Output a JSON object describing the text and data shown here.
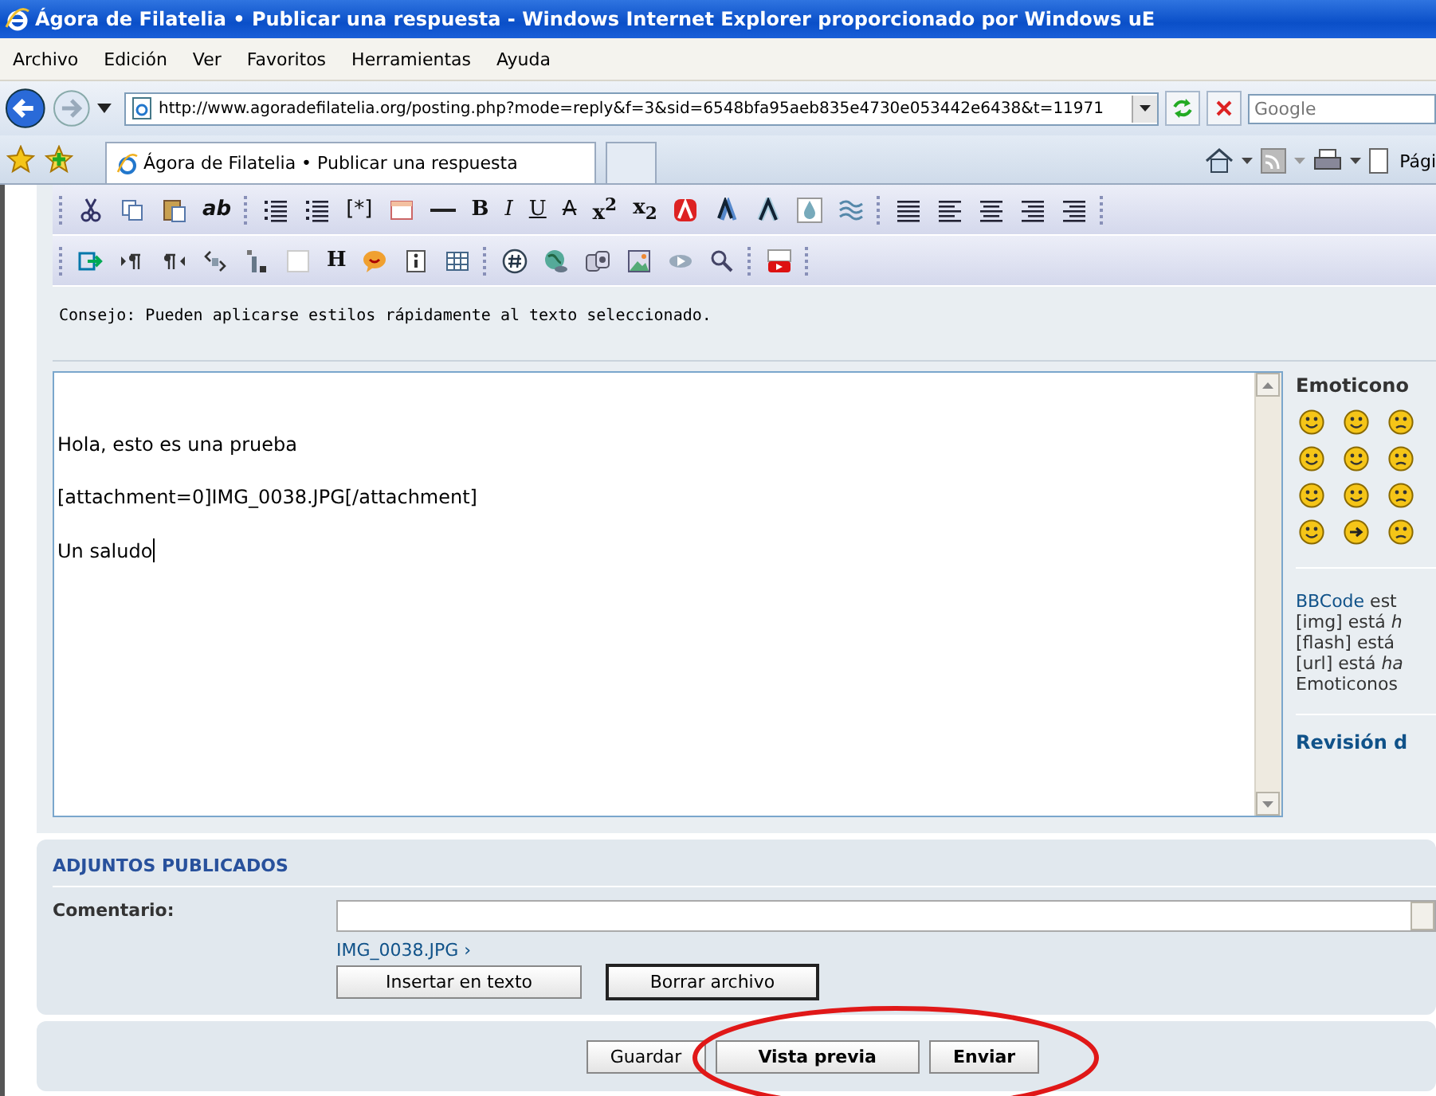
{
  "window": {
    "title": "Ágora de Filatelia • Publicar una respuesta - Windows Internet Explorer proporcionado por Windows uE"
  },
  "menu": [
    "Archivo",
    "Edición",
    "Ver",
    "Favoritos",
    "Herramientas",
    "Ayuda"
  ],
  "address_bar": {
    "url": "http://www.agoradefilatelia.org/posting.php?mode=reply&f=3&sid=6548bfa95aeb835e4730e053442e6438&t=11971",
    "search_placeholder": "Google"
  },
  "tabs": [
    {
      "label": "Ágora de Filatelia • Publicar una respuesta",
      "selected": true
    }
  ],
  "command_bar": {
    "page_label": "Pági"
  },
  "toolbar_rows": [
    [
      {
        "kind": "icon"
      },
      {
        "kind": "icon"
      },
      {
        "kind": "icon"
      },
      {
        "kind": "text",
        "text": "ab"
      },
      {
        "kind": "separator"
      },
      {
        "kind": "icon"
      },
      {
        "kind": "icon"
      },
      {
        "kind": "text",
        "text": "[*]"
      },
      {
        "kind": "icon"
      },
      {
        "kind": "icon"
      },
      {
        "kind": "text",
        "text": "B"
      },
      {
        "kind": "text",
        "text": "I"
      },
      {
        "kind": "text",
        "text": "U"
      },
      {
        "kind": "text",
        "text": "A"
      },
      {
        "kind": "text",
        "text": "x$^{2}$"
      },
      {
        "kind": "text",
        "text": "x$_{2}$"
      },
      {
        "kind": "icon"
      },
      {
        "kind": "icon"
      },
      {
        "kind": "icon"
      },
      {
        "kind": "icon"
      },
      {
        "kind": "icon"
      },
      {
        "kind": "separator"
      },
      {
        "kind": "icon"
      },
      {
        "kind": "icon"
      },
      {
        "kind": "icon"
      },
      {
        "kind": "icon"
      },
      {
        "kind": "icon"
      },
      {
        "kind": "separator"
      }
    ],
    [
      {
        "kind": "icon"
      },
      {
        "kind": "icon"
      },
      {
        "kind": "icon"
      },
      {
        "kind": "icon"
      },
      {
        "kind": "icon"
      },
      {
        "kind": "icon"
      },
      {
        "kind": "text",
        "text": "H"
      },
      {
        "kind": "icon"
      },
      {
        "kind": "icon"
      },
      {
        "kind": "icon"
      },
      {
        "kind": "separator"
      },
      {
        "kind": "icon"
      },
      {
        "kind": "icon"
      },
      {
        "kind": "icon"
      },
      {
        "kind": "icon"
      },
      {
        "kind": "icon"
      },
      {
        "kind": "icon"
      },
      {
        "kind": "separator"
      },
      {
        "kind": "icon"
      },
      {
        "kind": "separator"
      }
    ]
  ],
  "hint": "Consejo: Pueden aplicarse estilos rápidamente al texto seleccionado.",
  "message": {
    "lines": [
      "Hola, esto es una prueba",
      "[attachment=0]IMG_0038.JPG[/attachment]",
      "Un saludo"
    ]
  },
  "sidebar": {
    "emoticons_title": "Emoticono",
    "bbcode_link": "BBCode",
    "bbcode_rest": " est",
    "status_lines": [
      "[img] está *h*",
      "[flash] está",
      "[url] está *ha*",
      "Emoticonos"
    ],
    "review_title": "Revisión d"
  },
  "attachments": {
    "title": "ADJUNTOS PUBLICADOS",
    "comment_label": "Comentario:",
    "file": "IMG_0038.JPG",
    "file_marker": "›",
    "buttons": [
      {
        "label": "Insertar en texto",
        "focused": false
      },
      {
        "label": "Borrar archivo",
        "focused": true
      }
    ]
  },
  "actions": [
    {
      "label": "Guardar"
    },
    {
      "label": "Vista previa"
    },
    {
      "label": "Enviar"
    }
  ]
}
